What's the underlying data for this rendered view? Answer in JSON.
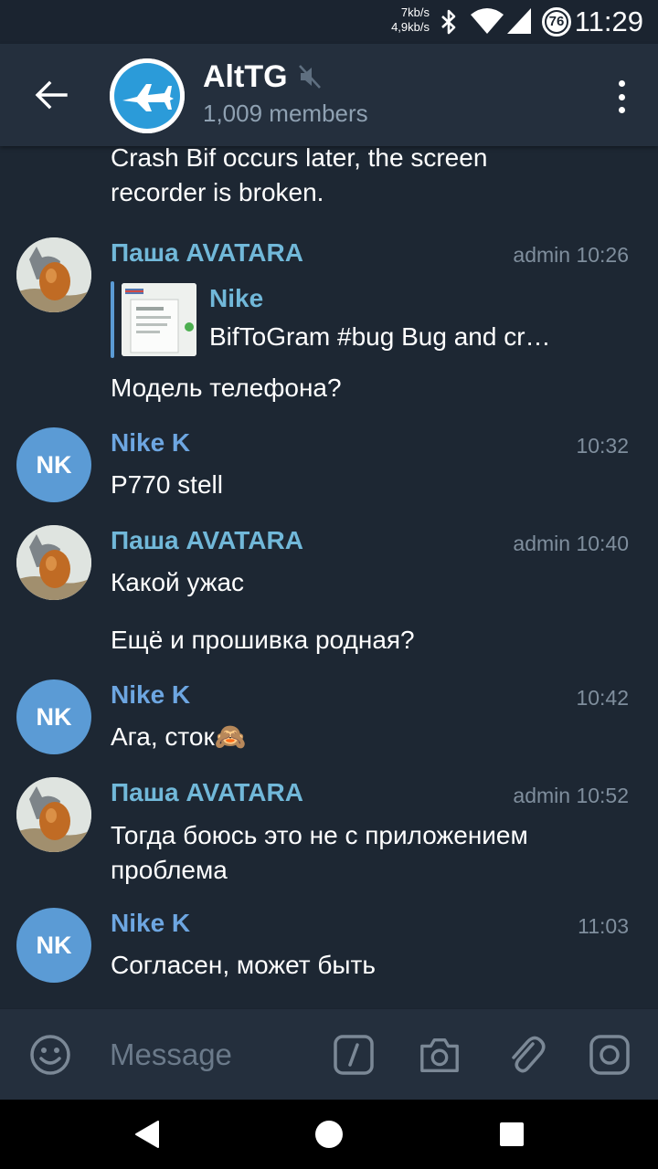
{
  "status_bar": {
    "net_up": "7kb/s",
    "net_down": "4,9kb/s",
    "battery": "76",
    "time": "11:29"
  },
  "header": {
    "title": "AltTG",
    "subtitle": "1,009 members"
  },
  "messages": {
    "m0_text": "Crash Bif occurs later, the screen recorder is broken.",
    "m1_sender": "Паша AVATARA",
    "m1_meta": "admin 10:26",
    "m1_reply_name": "Nike",
    "m1_reply_text": "BifToGram #bug  Bug and cr…",
    "m1_text": "Модель телефона?",
    "m2_initials": "NK",
    "m2_sender": "Nike K",
    "m2_meta": "10:32",
    "m2_text": "P770 stell",
    "m3_sender": "Паша AVATARA",
    "m3_meta": "admin 10:40",
    "m3_text": "Какой ужас",
    "m3b_text": "Ещё и прошивка родная?",
    "m4_initials": "NK",
    "m4_sender": "Nike K",
    "m4_meta": "10:42",
    "m4_text": "Ага, сток🙈",
    "m5_sender": "Паша AVATARA",
    "m5_meta": "admin 10:52",
    "m5_text": "Тогда боюсь это не с приложением проблема",
    "m6_initials": "NK",
    "m6_sender": "Nike K",
    "m6_meta": "11:03",
    "m6_text": "Согласен, может быть"
  },
  "input": {
    "placeholder": "Message"
  },
  "colors": {
    "background": "#1d2733",
    "header": "#242f3d",
    "sender_pasha": "#71b8d9",
    "sender_nike": "#6da6e1",
    "avatar_nk": "#5b9bd5",
    "meta": "#7f8e9d"
  },
  "icons": [
    "back-arrow-icon",
    "muted-speaker-icon",
    "more-vertical-icon",
    "emoji-icon",
    "slash-command-icon",
    "camera-icon",
    "attach-icon",
    "instagram-icon",
    "nav-back-icon",
    "nav-home-icon",
    "nav-recents-icon"
  ]
}
